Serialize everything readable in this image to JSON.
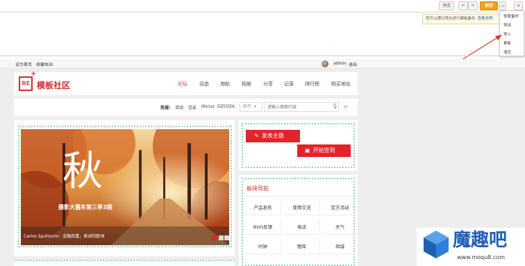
{
  "toolbar": {
    "preview_label": "预览",
    "save_label": "保存",
    "close_label": "✕"
  },
  "tip": {
    "text": "您可以通过导出进行模板备份",
    "link": "查看说明"
  },
  "menu": {
    "items": [
      "恢复备份",
      "导出",
      "导入",
      "更新",
      "清空"
    ]
  },
  "colors": {
    "brand_red": "#d52a2a",
    "save_orange": "#f0a21b",
    "dashed_border": "#8fd3c2",
    "annotation_arrow": "#d9342b"
  },
  "sitebar": {
    "set_home": "设为首页",
    "bookmark": "收藏本站",
    "user": "admin",
    "logout": "退出"
  },
  "logo": {
    "mark": "DZ",
    "text": "模板社区"
  },
  "nav": {
    "items": [
      "论坛",
      "动态",
      "淘帖",
      "相册",
      "分享",
      "记录",
      "排行榜",
      "购买地址"
    ]
  },
  "search": {
    "hot_label": "热搜:",
    "hot_terms": [
      "活动",
      "交友",
      "discuz",
      "DZCOOL"
    ],
    "category": "帖子",
    "placeholder": "请输入搜索内容"
  },
  "slide": {
    "big_char": "秋",
    "subtitle": "摄影大篷车第三季3期",
    "caption": "Carlos Spottorno：金融四重，表述的欧洲"
  },
  "actions": {
    "post": "发表主题",
    "signin": "开始签到"
  },
  "forums": {
    "title": "板块导航",
    "items": [
      "产品发布",
      "使用交流",
      "官方活动",
      "BUG反馈",
      "电话",
      "天气",
      "时钟",
      "图库",
      "商城"
    ]
  },
  "watermark": {
    "brand": "魔趣吧",
    "url": "www.moqu8.com"
  }
}
